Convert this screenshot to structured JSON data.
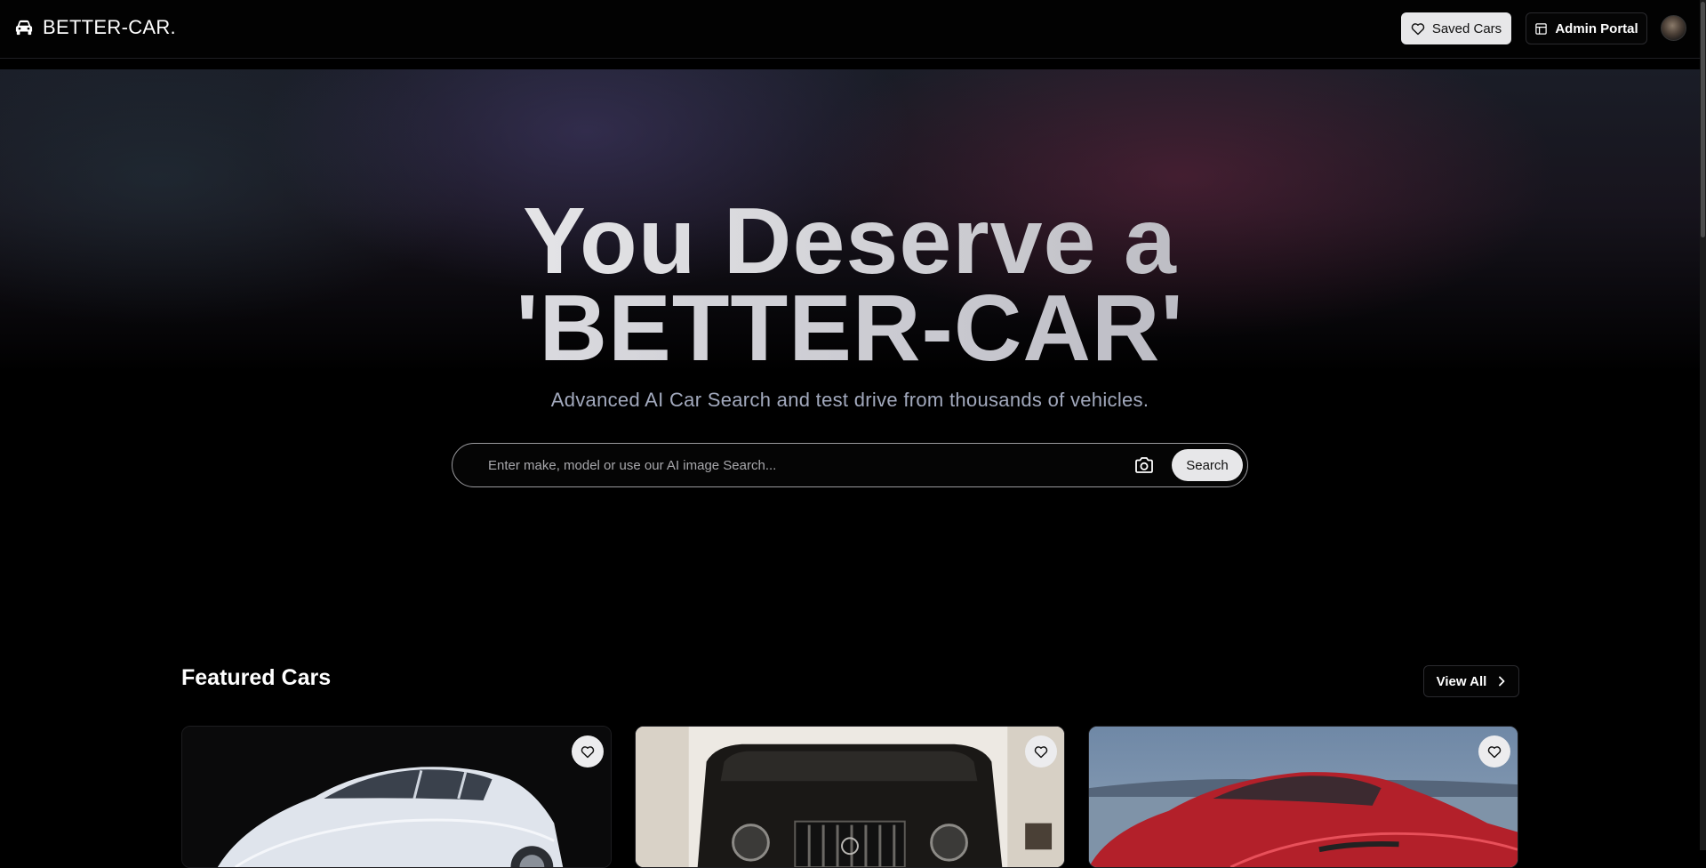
{
  "header": {
    "brand": "BETTER-CAR.",
    "saved_label": "Saved Cars",
    "admin_label": "Admin Portal"
  },
  "hero": {
    "title_line1": "You Deserve a",
    "title_line2": "'BETTER-CAR'",
    "subtitle": "Advanced AI Car Search and test drive from thousands of vehicles.",
    "search_placeholder": "Enter make, model or use our AI image Search...",
    "search_button": "Search"
  },
  "featured": {
    "title": "Featured Cars",
    "view_all_label": "View All",
    "cars": [
      {
        "image": "white-sedan",
        "color": "#e8ecf3"
      },
      {
        "image": "black-suv",
        "color": "#1a1816"
      },
      {
        "image": "red-crossover",
        "color": "#b3202a"
      }
    ]
  },
  "colors": {
    "background": "#000000",
    "accent_button": "#e7e7e9",
    "subtitle": "#a2a9bd"
  }
}
